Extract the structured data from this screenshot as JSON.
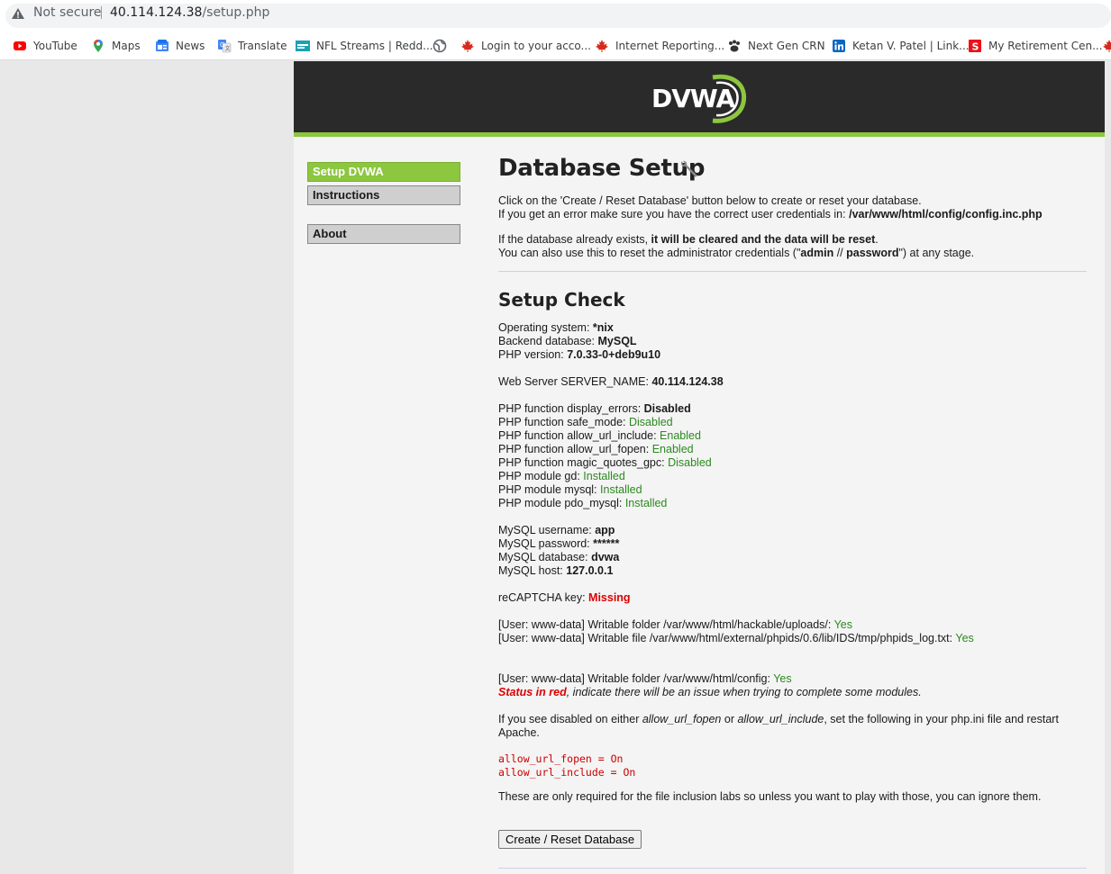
{
  "browser": {
    "security": "Not secure",
    "url_host": "40.114.124.38",
    "url_path": "/setup.php",
    "bookmarks": [
      {
        "label": "YouTube",
        "icon": "youtube-icon"
      },
      {
        "label": "Maps",
        "icon": "maps-pin-icon"
      },
      {
        "label": "News",
        "icon": "news-icon"
      },
      {
        "label": "Translate",
        "icon": "translate-icon"
      },
      {
        "label": "NFL Streams | Redd...",
        "icon": "nfl-streams-icon"
      },
      {
        "label": "",
        "icon": "globe-icon"
      },
      {
        "label": "Login to your acco...",
        "icon": "maple-leaf-icon"
      },
      {
        "label": "Internet Reporting...",
        "icon": "maple-leaf-icon"
      },
      {
        "label": "Next Gen CRN",
        "icon": "paw-icon"
      },
      {
        "label": "Ketan V. Patel | Link...",
        "icon": "linkedin-icon"
      },
      {
        "label": "My Retirement Cen...",
        "icon": "scotiabank-icon"
      }
    ]
  },
  "logo_text": "DVWA",
  "menu": {
    "setup": "Setup DVWA",
    "instructions": "Instructions",
    "about": "About"
  },
  "main": {
    "title": "Database Setup",
    "intro1": "Click on the 'Create / Reset Database' button below to create or reset your database.",
    "intro2_pre": "If you get an error make sure you have the correct user credentials in: ",
    "intro2_path": "/var/www/html/config/config.inc.php",
    "intro3_pre": "If the database already exists, ",
    "intro3_bold": "it will be cleared and the data will be reset",
    "intro3_post": ".",
    "intro4_pre": "You can also use this to reset the administrator credentials (\"",
    "intro4_admin": "admin",
    "intro4_mid": " // ",
    "intro4_pass": "password",
    "intro4_post": "\") at any stage.",
    "check_title": "Setup Check",
    "os_label": "Operating system: ",
    "os_value": "*nix",
    "db_label": "Backend database: ",
    "db_value": "MySQL",
    "php_label": "PHP version: ",
    "php_value": "7.0.33-0+deb9u10",
    "server_label": "Web Server SERVER_NAME: ",
    "server_value": "40.114.124.38",
    "fn": [
      {
        "label": "PHP function display_errors: ",
        "value": "Disabled",
        "style": "bold"
      },
      {
        "label": "PHP function safe_mode: ",
        "value": "Disabled",
        "style": "ok"
      },
      {
        "label": "PHP function allow_url_include: ",
        "value": "Enabled",
        "style": "ok"
      },
      {
        "label": "PHP function allow_url_fopen: ",
        "value": "Enabled",
        "style": "ok"
      },
      {
        "label": "PHP function magic_quotes_gpc: ",
        "value": "Disabled",
        "style": "ok"
      },
      {
        "label": "PHP module gd: ",
        "value": "Installed",
        "style": "ok"
      },
      {
        "label": "PHP module mysql: ",
        "value": "Installed",
        "style": "ok"
      },
      {
        "label": "PHP module pdo_mysql: ",
        "value": "Installed",
        "style": "ok"
      }
    ],
    "mysql_user_label": "MySQL username: ",
    "mysql_user": "app",
    "mysql_pass_label": "MySQL password: ",
    "mysql_pass": "******",
    "mysql_db_label": "MySQL database: ",
    "mysql_db": "dvwa",
    "mysql_host_label": "MySQL host: ",
    "mysql_host": "127.0.0.1",
    "recaptcha_label": "reCAPTCHA key: ",
    "recaptcha_value": "Missing",
    "w1_label": "[User: www-data] Writable folder /var/www/html/hackable/uploads/: ",
    "w1_value": "Yes",
    "w2_label": "[User: www-data] Writable file /var/www/html/external/phpids/0.6/lib/IDS/tmp/phpids_log.txt: ",
    "w2_value": "Yes",
    "w3_label": "[User: www-data] Writable folder /var/www/html/config: ",
    "w3_value": "Yes",
    "status_red": "Status in red",
    "status_rest": ", indicate there will be an issue when trying to complete some modules.",
    "disabled_pre": "If you see disabled on either ",
    "disabled_a": "allow_url_fopen",
    "disabled_or": " or ",
    "disabled_b": "allow_url_include",
    "disabled_post": ", set the following in your php.ini file and restart",
    "disabled_line2": "Apache.",
    "code1": "allow_url_fopen = On",
    "code2": "allow_url_include = On",
    "labs_note": "These are only required for the file inclusion labs so unless you want to play with those, you can ignore them.",
    "button": "Create / Reset Database"
  }
}
